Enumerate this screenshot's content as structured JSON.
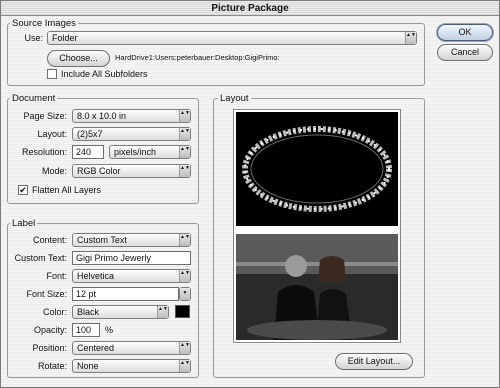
{
  "window": {
    "title": "Picture Package"
  },
  "buttons": {
    "ok": "OK",
    "cancel": "Cancel",
    "choose": "Choose...",
    "edit_layout": "Edit Layout..."
  },
  "source": {
    "title": "Source Images",
    "use_label": "Use:",
    "use_value": "Folder",
    "path": "HardDrive1:Users:peterbauer:Desktop:GigiPrimo:",
    "include_subfolders": "Include All Subfolders",
    "include_subfolders_checked": false
  },
  "document": {
    "title": "Document",
    "page_size_label": "Page Size:",
    "page_size": "8.0 x 10.0 in",
    "layout_label": "Layout:",
    "layout": "(2)5x7",
    "resolution_label": "Resolution:",
    "resolution": "240",
    "resolution_unit": "pixels/inch",
    "mode_label": "Mode:",
    "mode": "RGB Color",
    "flatten_label": "Flatten All Layers",
    "flatten_checked": true,
    "check_glyph": "✔"
  },
  "label": {
    "title": "Label",
    "content_label": "Content:",
    "content": "Custom Text",
    "custom_text_label": "Custom Text:",
    "custom_text": "Gigi Primo Jewerly",
    "font_label": "Font:",
    "font": "Helvetica",
    "font_size_label": "Font Size:",
    "font_size": "12 pt",
    "color_label": "Color:",
    "color": "Black",
    "color_swatch": "#000000",
    "opacity_label": "Opacity:",
    "opacity": "100",
    "opacity_unit": "%",
    "position_label": "Position:",
    "position": "Centered",
    "rotate_label": "Rotate:",
    "rotate": "None"
  },
  "layout_panel": {
    "title": "Layout"
  },
  "icons": {
    "popup_arrows": "▲▼",
    "popup_arrow_down": "▼"
  }
}
